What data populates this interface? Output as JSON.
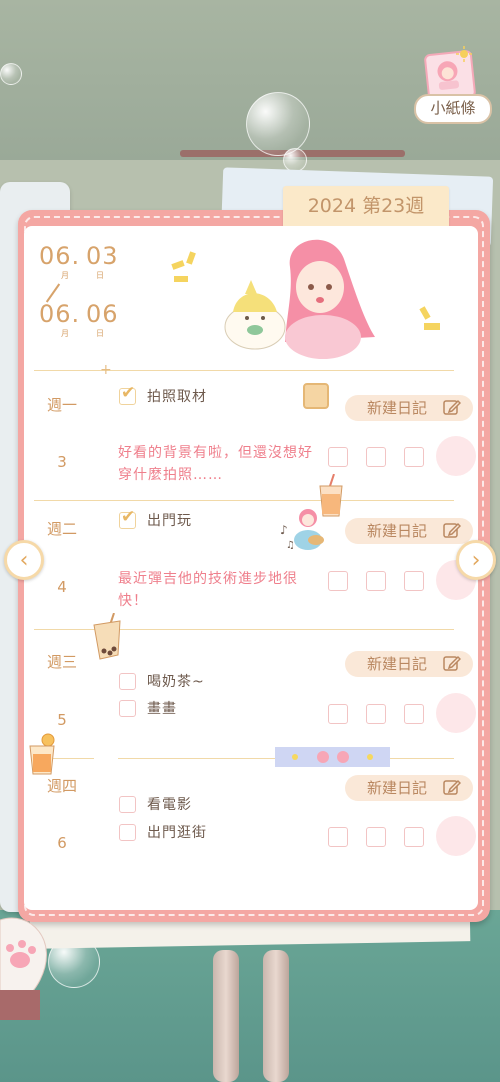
{
  "sticker_button": {
    "label": "小紙條",
    "icon": "sticker-note-icon"
  },
  "notebook": {
    "week_tab": "2024 第23週",
    "date_range": {
      "start_month": "06.",
      "start_day": "03",
      "end_month": "06.",
      "end_day": "06",
      "month_caption": "月",
      "day_caption": "日"
    },
    "new_diary_label": "新建日記",
    "days": [
      {
        "weekday": "週一",
        "day": "3",
        "tasks": [
          {
            "text": "拍照取材",
            "checked": true
          }
        ],
        "note": "好看的背景有啦，但還沒想好穿什麼拍照……"
      },
      {
        "weekday": "週二",
        "day": "4",
        "tasks": [
          {
            "text": "出門玩",
            "checked": true
          }
        ],
        "note": "最近彈吉他的技術進步地很快！"
      },
      {
        "weekday": "週三",
        "day": "5",
        "tasks": [
          {
            "text": "喝奶茶~",
            "checked": false
          },
          {
            "text": "畫畫",
            "checked": false
          }
        ],
        "note": ""
      },
      {
        "weekday": "週四",
        "day": "6",
        "tasks": [
          {
            "text": "看電影",
            "checked": false
          },
          {
            "text": "出門逛街",
            "checked": false
          }
        ],
        "note": ""
      }
    ]
  },
  "nav": {
    "prev_icon": "chevron-left-icon",
    "next_icon": "chevron-right-icon",
    "prev_glyph": "‹",
    "next_glyph": "›"
  },
  "colors": {
    "frame": "#f4a7a3",
    "accent_text": "#d29a63",
    "note_text": "#ef7f8c",
    "button_bg": "#fae8d8"
  }
}
